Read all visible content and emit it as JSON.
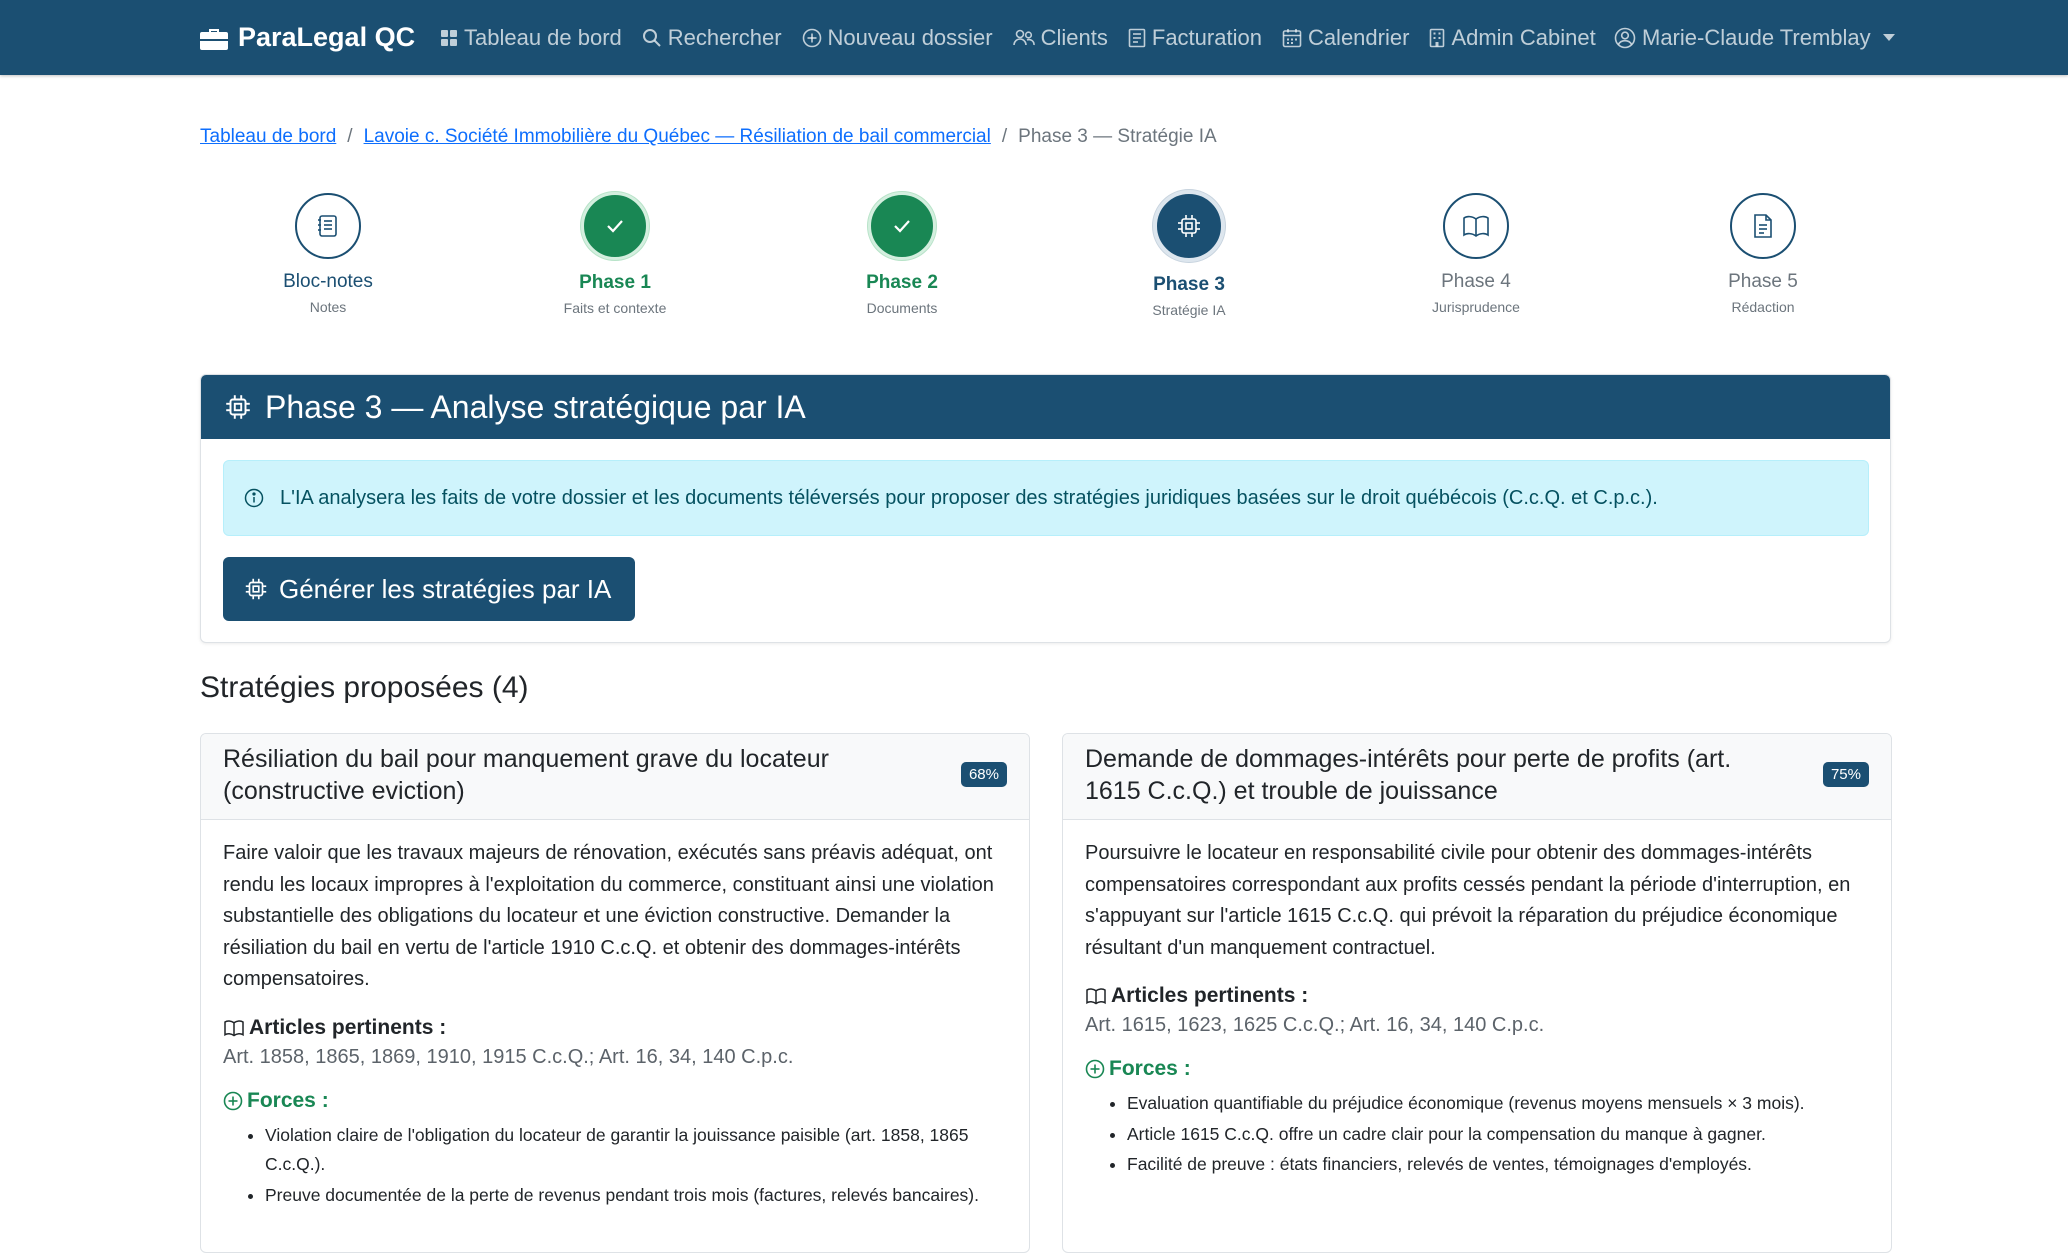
{
  "navbar": {
    "brand": "ParaLegal QC",
    "links": [
      {
        "label": "Tableau de bord",
        "icon": "grid-icon"
      },
      {
        "label": "Rechercher",
        "icon": "search-icon"
      },
      {
        "label": "Nouveau dossier",
        "icon": "plus-circle-icon"
      },
      {
        "label": "Clients",
        "icon": "people-icon"
      },
      {
        "label": "Facturation",
        "icon": "receipt-icon"
      },
      {
        "label": "Calendrier",
        "icon": "calendar-icon"
      },
      {
        "label": "Admin Cabinet",
        "icon": "building-icon"
      }
    ],
    "user": "Marie-Claude Tremblay"
  },
  "breadcrumb": {
    "home": "Tableau de bord",
    "case": "Lavoie c. Société Immobilière du Québec — Résiliation de bail commercial",
    "current": "Phase 3 — Stratégie IA",
    "separator": "/"
  },
  "stepper": [
    {
      "title": "Bloc-notes",
      "sub": "Notes",
      "state": "future-primary",
      "icon": "notepad-icon"
    },
    {
      "title": "Phase 1",
      "sub": "Faits et contexte",
      "state": "done",
      "icon": "check-icon"
    },
    {
      "title": "Phase 2",
      "sub": "Documents",
      "state": "done",
      "icon": "check-icon"
    },
    {
      "title": "Phase 3",
      "sub": "Stratégie IA",
      "state": "active",
      "icon": "cpu-icon"
    },
    {
      "title": "Phase 4",
      "sub": "Jurisprudence",
      "state": "future",
      "icon": "book-icon"
    },
    {
      "title": "Phase 5",
      "sub": "Rédaction",
      "state": "future",
      "icon": "document-icon"
    }
  ],
  "phase": {
    "header": "Phase 3 — Analyse stratégique par IA",
    "info": "L'IA analysera les faits de votre dossier et les documents téléversés pour proposer des stratégies juridiques basées sur le droit québécois (C.c.Q. et C.p.c.).",
    "button": "Générer les stratégies par IA"
  },
  "strategies": {
    "title": "Stratégies proposées (4)",
    "articles_label": "Articles pertinents :",
    "forces_label": "Forces :",
    "items": [
      {
        "title": "Résiliation du bail pour manquement grave du locateur (constructive eviction)",
        "confidence": "68%",
        "description": "Faire valoir que les travaux majeurs de rénovation, exécutés sans préavis adéquat, ont rendu les locaux impropres à l'exploitation du commerce, constituant ainsi une violation substantielle des obligations du locateur et une éviction constructive. Demander la résiliation du bail en vertu de l'article 1910 C.c.Q. et obtenir des dommages-intérêts compensatoires.",
        "articles": "Art. 1858, 1865, 1869, 1910, 1915 C.c.Q.; Art. 16, 34, 140 C.p.c.",
        "forces": [
          "Violation claire de l'obligation du locateur de garantir la jouissance paisible (art. 1858, 1865 C.c.Q.).",
          "Preuve documentée de la perte de revenus pendant trois mois (factures, relevés bancaires)."
        ]
      },
      {
        "title": "Demande de dommages-intérêts pour perte de profits (art. 1615 C.c.Q.) et trouble de jouissance",
        "confidence": "75%",
        "description": "Poursuivre le locateur en responsabilité civile pour obtenir des dommages-intérêts compensatoires correspondant aux profits cessés pendant la période d'interruption, en s'appuyant sur l'article 1615 C.c.Q. qui prévoit la réparation du préjudice économique résultant d'un manquement contractuel.",
        "articles": "Art. 1615, 1623, 1625 C.c.Q.; Art. 16, 34, 140 C.p.c.",
        "forces": [
          "Evaluation quantifiable du préjudice économique (revenus moyens mensuels × 3 mois).",
          "Article 1615 C.c.Q. offre un cadre clair pour la compensation du manque à gagner.",
          "Facilité de preuve : états financiers, relevés de ventes, témoignages d'employés."
        ]
      }
    ]
  }
}
